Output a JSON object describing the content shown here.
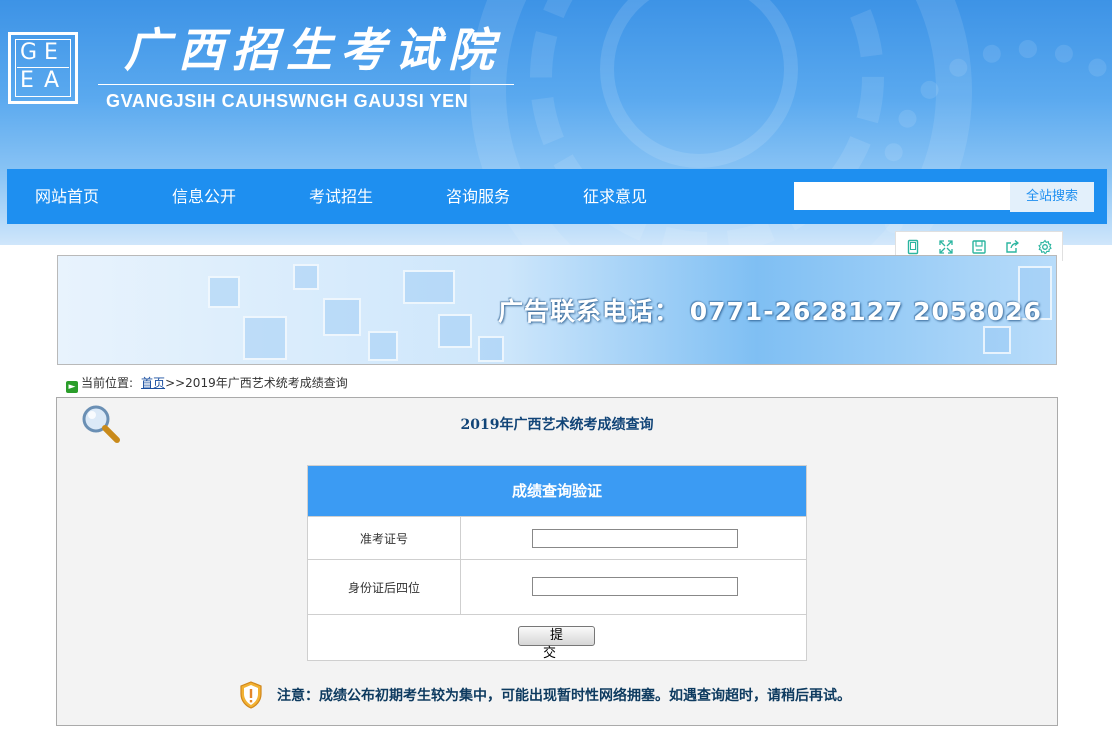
{
  "header": {
    "logo_letters": [
      "G",
      "E",
      "E",
      "A"
    ],
    "title": "广西招生考试院",
    "subtitle": "GVANGJSIH CAUHSWNGH GAUJSI YEN"
  },
  "nav": {
    "items": [
      {
        "label": "网站首页"
      },
      {
        "label": "信息公开"
      },
      {
        "label": "考试招生"
      },
      {
        "label": "咨询服务"
      },
      {
        "label": "征求意见"
      }
    ],
    "search": {
      "placeholder": "",
      "value": "",
      "button_label": "全站搜索"
    }
  },
  "tools": {
    "icons": [
      "mobile-icon",
      "fullscreen-icon",
      "save-icon",
      "share-icon",
      "settings-icon"
    ]
  },
  "banner": {
    "text": "广告联系电话： 0771-2628127  2058026"
  },
  "breadcrumb": {
    "prefix": "当前位置:",
    "home_link": "首页",
    "current": ">>2019年广西艺术统考成绩查询"
  },
  "panel": {
    "title": "2019年广西艺术统考成绩查询",
    "form": {
      "heading": "成绩查询验证",
      "fields": [
        {
          "label": "准考证号",
          "value": ""
        },
        {
          "label": "身份证后四位",
          "value": ""
        }
      ],
      "submit_label": "提 交"
    },
    "notice": "注意：成绩公布初期考生较为集中，可能出现暂时性网络拥塞。如遇查询超时，请稍后再试。"
  },
  "colors": {
    "nav_bg": "#1e8ff0",
    "form_header_bg": "#3b9bf3",
    "panel_title": "#114477"
  }
}
